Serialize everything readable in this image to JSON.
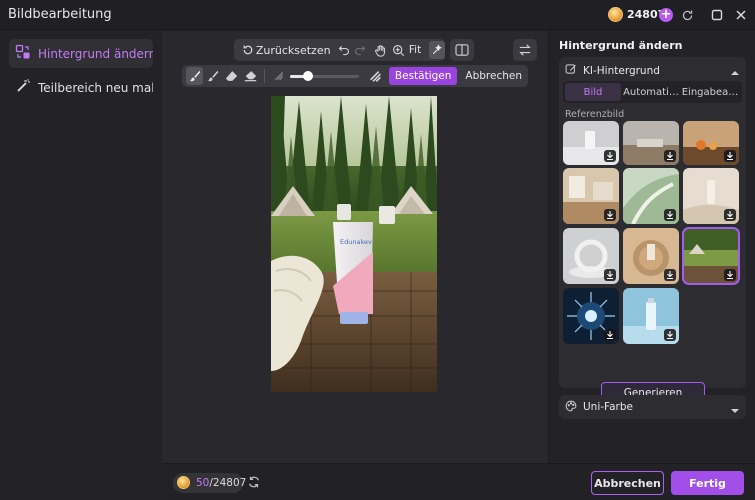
{
  "window": {
    "title": "Bildbearbeitung",
    "credits": "24807"
  },
  "sidebar": {
    "items": [
      {
        "label": "Hintergrund ändern",
        "active": true
      },
      {
        "label": "Teilbereich neu mal…",
        "active": false
      }
    ]
  },
  "toolbar": {
    "reset_label": "Zurücksetzen",
    "fit_label": "Fit",
    "confirm_label": "Bestätigen",
    "cancel_label": "Abbrechen",
    "brush_size_fraction": 0.22
  },
  "product": {
    "brand": "Edunakev"
  },
  "bottom": {
    "usage_used": "50",
    "usage_total": "/24807",
    "cancel_label": "Abbrechen",
    "done_label": "Fertig"
  },
  "right_panel": {
    "heading": "Hintergrund ändern",
    "ai_section_title": "KI-Hintergrund",
    "tabs": [
      "Bild",
      "Automati…",
      "Eingabea…"
    ],
    "reference_label": "Referenzbild",
    "generate_label": "Generieren",
    "solid_color_title": "Uni-Farbe"
  },
  "colors": {
    "accent": "#a14fe8",
    "accent_text": "#c37bf5",
    "panel_bg": "#232327",
    "canvas_bg": "#28282d"
  }
}
